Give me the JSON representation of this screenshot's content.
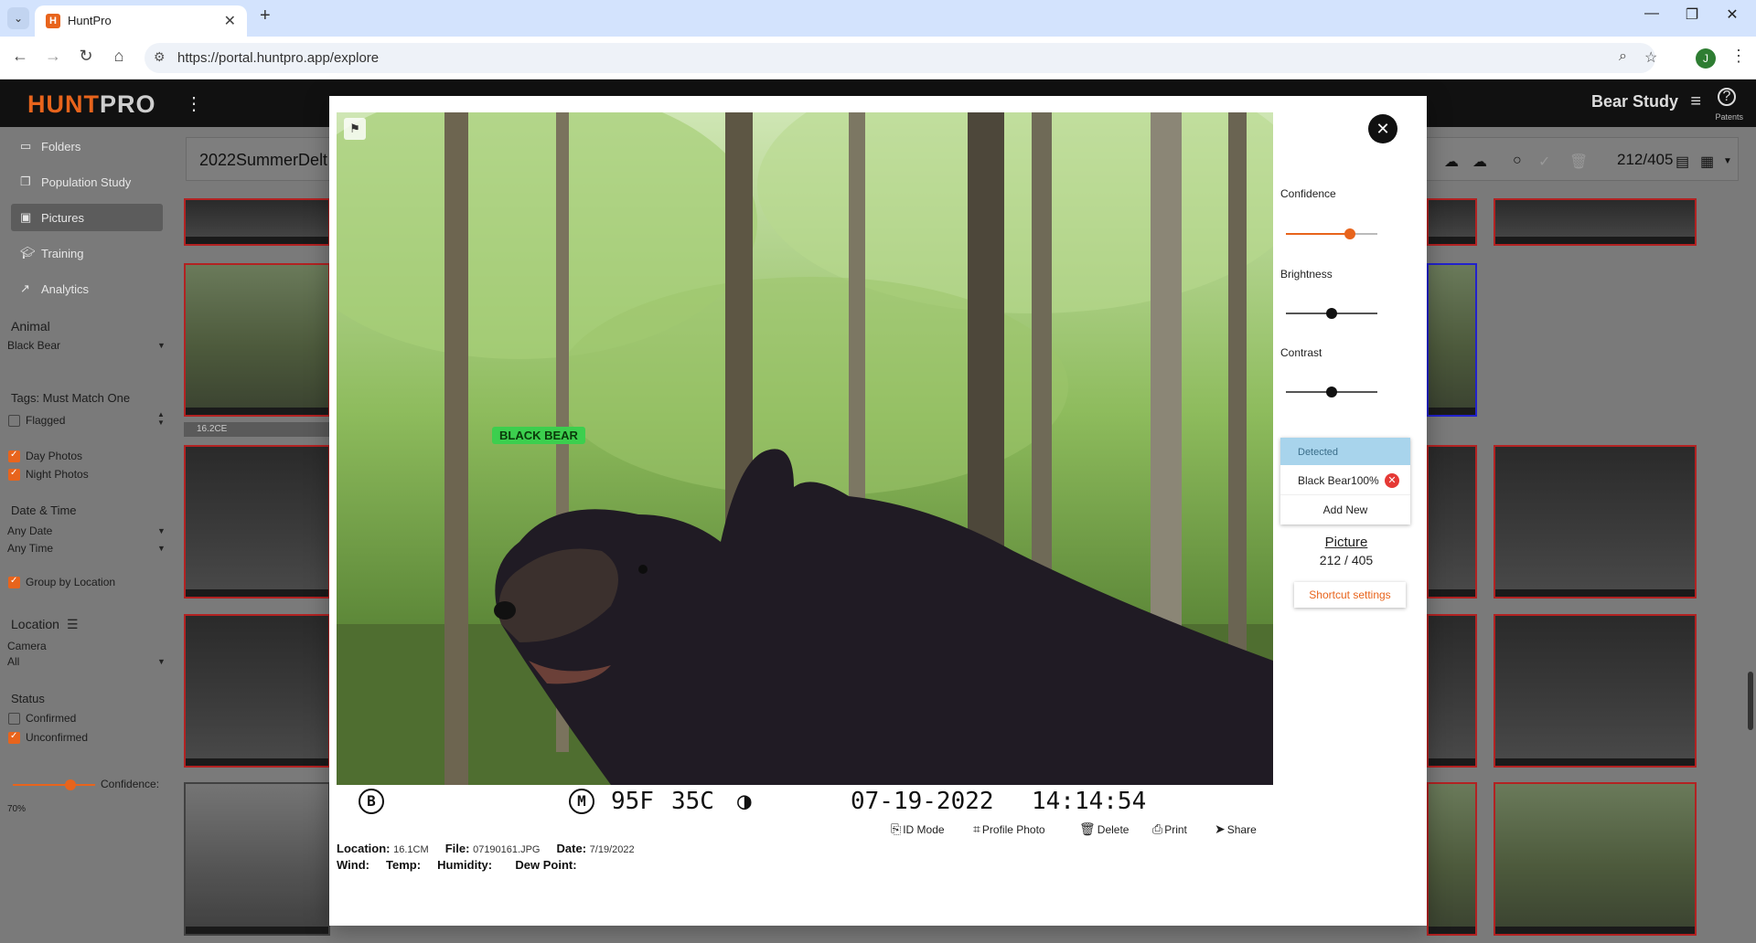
{
  "browser": {
    "tab_title": "HuntPro",
    "url": "https://portal.huntpro.app/explore",
    "profile_initial": "J"
  },
  "app": {
    "logo_hunt": "HUNT",
    "logo_pro": "PRO",
    "study_name": "Bear Study",
    "patents_label": "Patents"
  },
  "sidebar": {
    "nav": [
      {
        "label": "Folders",
        "icon": "folder-icon"
      },
      {
        "label": "Population Study",
        "icon": "copy-icon"
      },
      {
        "label": "Pictures",
        "icon": "image-icon"
      },
      {
        "label": "Training",
        "icon": "school-icon"
      },
      {
        "label": "Analytics",
        "icon": "chart-icon"
      }
    ],
    "animal_heading": "Animal",
    "animal_value": "Black Bear",
    "tags_heading": "Tags: Must Match One",
    "flagged_label": "Flagged",
    "day_photos_label": "Day Photos",
    "night_photos_label": "Night Photos",
    "datetime_heading": "Date & Time",
    "date_value": "Any Date",
    "time_value": "Any Time",
    "group_by_location_label": "Group by Location",
    "location_heading": "Location",
    "camera_label": "Camera",
    "camera_value": "All",
    "status_heading": "Status",
    "confirmed_label": "Confirmed",
    "unconfirmed_label": "Unconfirmed",
    "confidence_label": "Confidence:",
    "confidence_value": "70%",
    "confidence_fraction": 0.7,
    "checked": {
      "flagged": false,
      "day": true,
      "night": true,
      "group": true,
      "confirmed": false,
      "unconfirmed": true
    }
  },
  "grid": {
    "folder_name": "2022SummerDelt",
    "counter": "212/405",
    "camera_group_label": "16.2CE"
  },
  "modal": {
    "detection_label": "BLACK BEAR",
    "camera_strip": {
      "mode_b": "B",
      "mode_m": "M",
      "temp_f": "95F",
      "temp_c": "35C",
      "date": "07-19-2022",
      "time": "14:14:54"
    },
    "actions": [
      {
        "label": "ID Mode",
        "icon": "id-mode-icon"
      },
      {
        "label": "Profile Photo",
        "icon": "crop-icon"
      },
      {
        "label": "Delete",
        "icon": "trash-icon"
      },
      {
        "label": "Print",
        "icon": "print-icon"
      },
      {
        "label": "Share",
        "icon": "share-icon"
      }
    ],
    "meta": {
      "location_label": "Location:",
      "location_value": "16.1CM",
      "file_label": "File:",
      "file_value": "07190161.JPG",
      "date_label": "Date:",
      "date_value": "7/19/2022",
      "wind_label": "Wind:",
      "temp_label": "Temp:",
      "humidity_label": "Humidity:",
      "dewpoint_label": "Dew Point:"
    },
    "controls": {
      "confidence_label": "Confidence",
      "brightness_label": "Brightness",
      "contrast_label": "Contrast",
      "confidence_level": 0.7,
      "brightness_level": 0.5,
      "contrast_level": 0.5
    },
    "detected_heading": "Detected",
    "detections": [
      {
        "name": "Black Bear",
        "score": "100%"
      }
    ],
    "add_new_label": "Add New",
    "picture_link": "Picture",
    "picture_count": "212 / 405",
    "shortcut_label": "Shortcut settings",
    "accent_color": "#e8641c"
  }
}
